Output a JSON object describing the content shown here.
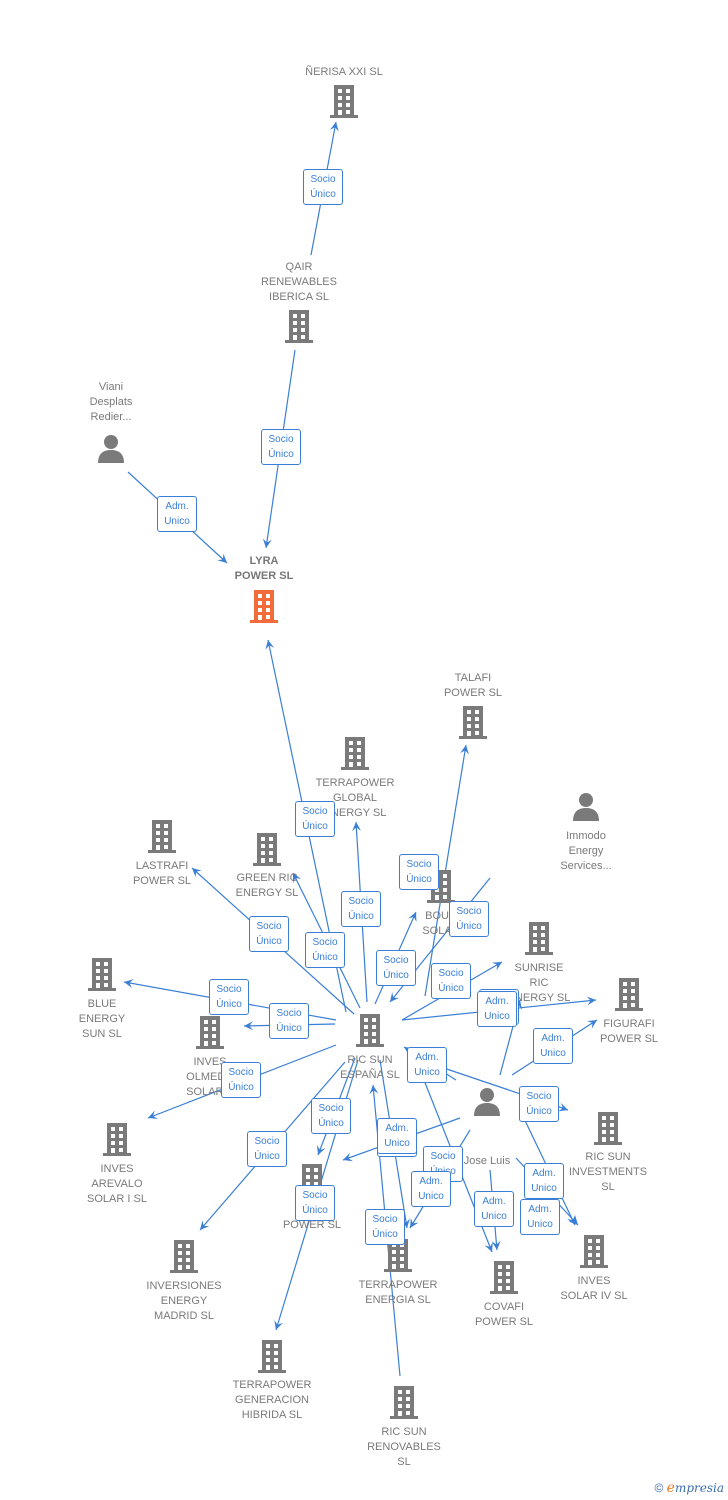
{
  "colors": {
    "edge": "#3a7fd5",
    "company": "#7a7a7a",
    "focus_company": "#f26b3a",
    "person": "#7a7a7a"
  },
  "nodes": [
    {
      "id": "nerisa",
      "type": "company",
      "label": "ÑERISA XXI  SL"
    },
    {
      "id": "qair",
      "type": "company",
      "label": "QAIR\nRENEWABLES\nIBERICA  SL"
    },
    {
      "id": "viani",
      "type": "person",
      "label": "Viani\nDesplats\nRedier..."
    },
    {
      "id": "lyra",
      "type": "company",
      "label": "LYRA\nPOWER  SL",
      "focus": true
    },
    {
      "id": "talafi",
      "type": "company",
      "label": "TALAFI\nPOWER  SL"
    },
    {
      "id": "tpglobal",
      "type": "company",
      "label": "TERRAPOWER\nGLOBAL\nENERGY  SL"
    },
    {
      "id": "immodo",
      "type": "person",
      "label": "Immodo\nEnergy\nServices..."
    },
    {
      "id": "lastrafi",
      "type": "company",
      "label": "LASTRAFI\nPOWER  SL"
    },
    {
      "id": "greenric",
      "type": "company",
      "label": "GREEN RIC\nENERGY  SL"
    },
    {
      "id": "boud",
      "type": "company",
      "label": "BOUD\nSOLAR"
    },
    {
      "id": "sunrise",
      "type": "company",
      "label": "SUNRISE\nRIC\nENERGY  SL"
    },
    {
      "id": "blue",
      "type": "company",
      "label": "BLUE\nENERGY\nSUN  SL"
    },
    {
      "id": "figurafi",
      "type": "company",
      "label": "FIGURAFI\nPOWER  SL"
    },
    {
      "id": "ricsun",
      "type": "company",
      "label": "RIC SUN\nESPAÑA  SL"
    },
    {
      "id": "olmedo",
      "type": "company",
      "label": "INVES\nOLMEDO\nSOLAR X"
    },
    {
      "id": "joseluis",
      "type": "person",
      "label": "Jose Luis"
    },
    {
      "id": "arevalo",
      "type": "company",
      "label": "INVES\nAREVALO\nSOLAR I  SL"
    },
    {
      "id": "ricinv",
      "type": "company",
      "label": "RIC SUN\nINVESTMENTS\nSL"
    },
    {
      "id": "tpower",
      "type": "company",
      "label": "T\nPOWER  SL"
    },
    {
      "id": "invsolar4",
      "type": "company",
      "label": "INVES\nSOLAR IV SL"
    },
    {
      "id": "invmadrid",
      "type": "company",
      "label": "INVERSIONES\nENERGY\nMADRID  SL"
    },
    {
      "id": "tpenergia",
      "type": "company",
      "label": "TERRAPOWER\nENERGIA  SL"
    },
    {
      "id": "covafi",
      "type": "company",
      "label": "COVAFI\nPOWER  SL"
    },
    {
      "id": "tpgen",
      "type": "company",
      "label": "TERRAPOWER\nGENERACION\nHIBRIDA  SL"
    },
    {
      "id": "ricren",
      "type": "company",
      "label": "RIC SUN\nRENOVABLES\nSL"
    }
  ],
  "edge_labels": {
    "socio": "Socio\nÚnico",
    "adm": "Adm.\nUnico"
  },
  "edges": [
    {
      "from": "qair",
      "to": "nerisa",
      "kind": "socio"
    },
    {
      "from": "qair",
      "to": "lyra",
      "kind": "socio"
    },
    {
      "from": "viani",
      "to": "lyra",
      "kind": "adm"
    },
    {
      "from": "ricsun",
      "to": "lyra",
      "kind": "socio"
    },
    {
      "from": "ricsun",
      "to": "talafi",
      "kind": "socio"
    },
    {
      "from": "ricsun",
      "to": "tpglobal",
      "kind": "socio"
    },
    {
      "from": "immodo",
      "to": "ricsun",
      "kind": "socio"
    },
    {
      "from": "ricsun",
      "to": "lastrafi",
      "kind": "socio"
    },
    {
      "from": "ricsun",
      "to": "greenric",
      "kind": "socio"
    },
    {
      "from": "ricsun",
      "to": "boud",
      "kind": "socio"
    },
    {
      "from": "ricsun",
      "to": "sunrise",
      "kind": "socio"
    },
    {
      "from": "ricsun",
      "to": "blue",
      "kind": "socio"
    },
    {
      "from": "ricsun",
      "to": "figurafi",
      "kind": "socio"
    },
    {
      "from": "ricsun",
      "to": "olmedo",
      "kind": "socio"
    },
    {
      "from": "ricsun",
      "to": "arevalo",
      "kind": "socio"
    },
    {
      "from": "ricsun",
      "to": "tpower",
      "kind": "socio"
    },
    {
      "from": "ricsun",
      "to": "invmadrid",
      "kind": "socio"
    },
    {
      "from": "ricsun",
      "to": "tpgen",
      "kind": "socio"
    },
    {
      "from": "ricsun",
      "to": "tpenergia",
      "kind": "socio"
    },
    {
      "from": "ricren",
      "to": "ricsun",
      "kind": "socio"
    },
    {
      "from": "ricsun",
      "to": "covafi",
      "kind": "socio"
    },
    {
      "from": "ricsun",
      "to": "invsolar4",
      "kind": "socio"
    },
    {
      "from": "joseluis",
      "to": "ricsun",
      "kind": "adm"
    },
    {
      "from": "joseluis",
      "to": "figurafi",
      "kind": "adm"
    },
    {
      "from": "joseluis",
      "to": "sunrise",
      "kind": "adm"
    },
    {
      "from": "joseluis",
      "to": "ricinv",
      "kind": "adm"
    },
    {
      "from": "joseluis",
      "to": "olmedo",
      "kind": "adm"
    },
    {
      "from": "joseluis",
      "to": "tpenergia",
      "kind": "adm"
    },
    {
      "from": "joseluis",
      "to": "covafi",
      "kind": "adm"
    },
    {
      "from": "joseluis",
      "to": "invsolar4",
      "kind": "adm"
    }
  ],
  "footer": {
    "copyright": "©",
    "brand_initial": "e",
    "brand_rest": "mpresia"
  }
}
